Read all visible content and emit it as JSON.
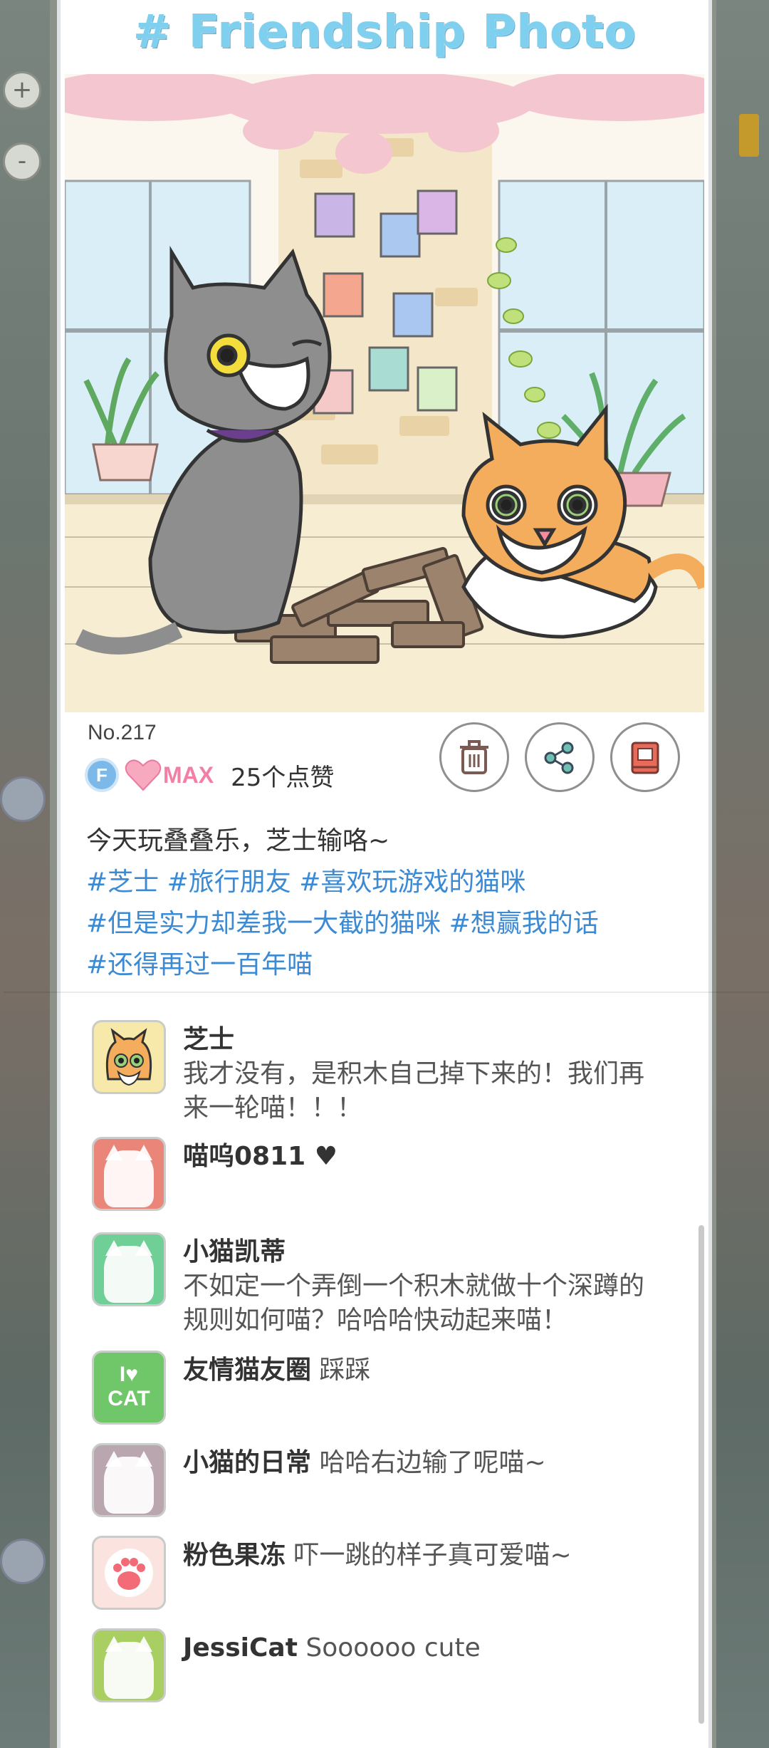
{
  "title": "# Friendship Photo",
  "photo": {
    "number": "No.217"
  },
  "likes": {
    "badge": "F",
    "level": "MAX",
    "count_text": "25个点赞"
  },
  "actions": {
    "delete_icon": "trash-icon",
    "share_icon": "share-icon",
    "album_icon": "album-icon"
  },
  "caption": {
    "text": "今天玩叠叠乐，芝士输咯~",
    "tag_lines": [
      "#芝士 #旅行朋友 #喜欢玩游戏的猫咪",
      "#但是实力却差我一大截的猫咪 #想赢我的话",
      "#还得再过一百年喵"
    ]
  },
  "comments": [
    {
      "name": "芝士",
      "text_lines": [
        "我才没有，是积木自己掉下来的！我们再",
        "来一轮喵！！！"
      ],
      "avatar_color": "#f6e9a9"
    },
    {
      "name": "喵呜0811 ♥",
      "text": "",
      "avatar_color": "#e98679"
    },
    {
      "name": "小猫凯蒂",
      "text_lines": [
        "不如定一个弄倒一个积木就做十个深蹲的",
        "规则如何喵？哈哈哈快动起来喵！"
      ],
      "avatar_color": "#6fcf97"
    },
    {
      "name": "友情猫友圈",
      "text": "踩踩",
      "avatar_color": "#6fc76a",
      "avatar_text_1": "I♥",
      "avatar_text_2": "CAT"
    },
    {
      "name": "小猫的日常",
      "text": "哈哈右边输了呢喵~",
      "avatar_color": "#b9a6ae"
    },
    {
      "name": "粉色果冻",
      "text": "吓一跳的样子真可爱喵~",
      "avatar_color": "#fbe3e0"
    },
    {
      "name": "JessiCat",
      "text": "Soooooo cute",
      "avatar_color": "#a9cf62"
    }
  ],
  "left_controls": {
    "zoom_in": "+",
    "zoom_out": "-"
  }
}
